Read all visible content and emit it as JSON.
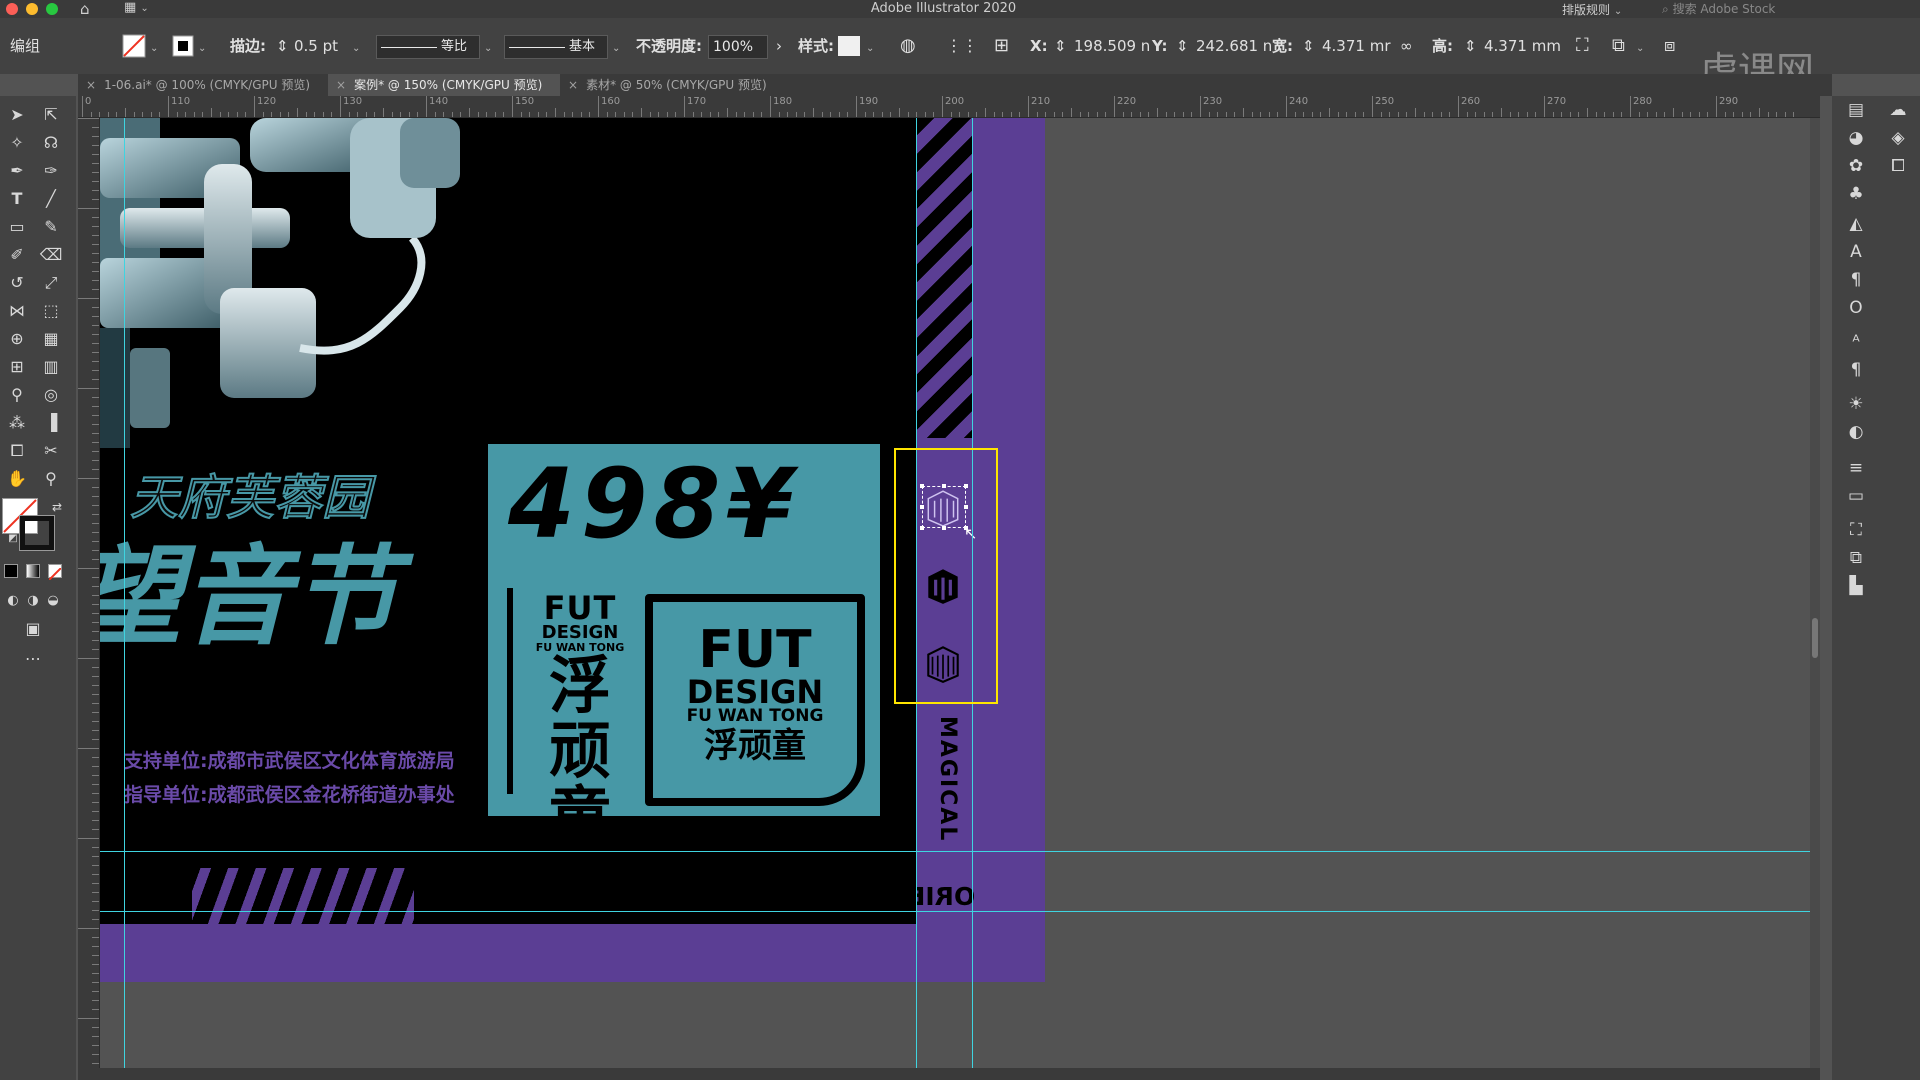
{
  "window": {
    "title": "Adobe Illustrator 2020",
    "home_icon": "home-icon",
    "workspace_icon": "workspace-switcher-icon"
  },
  "top_right": {
    "workspace": "排版规则",
    "stock_search_placeholder": "搜索 Adobe Stock"
  },
  "control_bar": {
    "selection_label": "编组",
    "stroke_label": "描边:",
    "stroke_value": "0.5 pt",
    "profile_label": "等比",
    "brush_label": "基本",
    "opacity_label": "不透明度:",
    "opacity_value": "100%",
    "style_label": "样式:",
    "x_label": "X:",
    "x_value": "198.509 n",
    "y_label": "Y:",
    "y_value": "242.681 n",
    "w_label": "宽:",
    "w_value": "4.371 mr",
    "h_label": "高:",
    "h_value": "4.371 mm"
  },
  "tabs": [
    {
      "label": "1-06.ai* @ 100% (CMYK/GPU 预览)",
      "active": false
    },
    {
      "label": "案例* @ 150% (CMYK/GPU 预览)",
      "active": true
    },
    {
      "label": "素材* @ 50% (CMYK/GPU 预览)",
      "active": false
    }
  ],
  "ruler": {
    "ticks": [
      "0",
      "110",
      "120",
      "130",
      "140",
      "150",
      "160",
      "170",
      "180",
      "190",
      "200",
      "210",
      "220",
      "230",
      "240",
      "250",
      "260",
      "270",
      "280",
      "290"
    ]
  },
  "artwork": {
    "price": "498¥",
    "venue": "天府芙蓉园",
    "event_partial": "音节",
    "event_cut_glyph": "望",
    "support_line": "支持单位:成都市武侯区文化体育旅游局",
    "guide_line": "指导单位:成都武侯区金花桥街道办事处",
    "logo_small": {
      "top": "FUT",
      "design": "DESIGN",
      "sub": "FU WAN TONG",
      "cn": "浮顽童"
    },
    "logo_big": {
      "top": "FUT",
      "design": "DESIGN",
      "sub": "FU WAN TONG",
      "cn": "浮顽童"
    },
    "vertical_text": "MAGICAL",
    "bottom_text": "ORIENTAL NIGHT-CEA SYLLABLE"
  },
  "colors": {
    "teal": "#4798a6",
    "purple": "#5b3e94",
    "guide": "#3fd4e0",
    "selection": "#ffe500"
  },
  "watermark": "虎课网"
}
